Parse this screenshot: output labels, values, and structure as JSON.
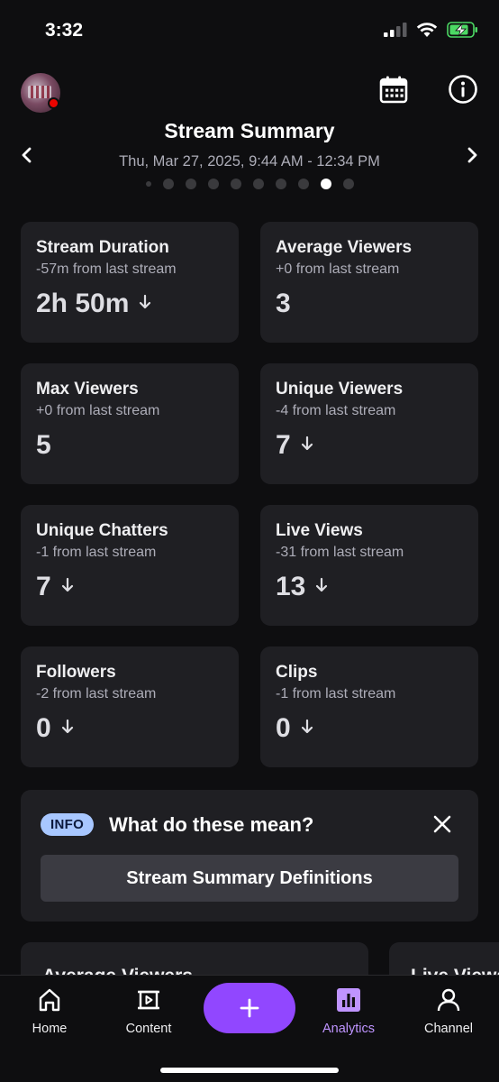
{
  "status_bar": {
    "time": "3:32"
  },
  "header": {
    "title": "Stream Summary",
    "date_range": "Thu, Mar 27, 2025, 9:44 AM - 12:34 PM",
    "pager_total": 10,
    "pager_active_index": 8
  },
  "stats": [
    {
      "title": "Stream Duration",
      "change": "-57m from last stream",
      "value": "2h 50m",
      "trend": "down"
    },
    {
      "title": "Average Viewers",
      "change": "+0 from last stream",
      "value": "3",
      "trend": "none"
    },
    {
      "title": "Max Viewers",
      "change": "+0 from last stream",
      "value": "5",
      "trend": "none"
    },
    {
      "title": "Unique Viewers",
      "change": "-4 from last stream",
      "value": "7",
      "trend": "down"
    },
    {
      "title": "Unique Chatters",
      "change": "-1 from last stream",
      "value": "7",
      "trend": "down"
    },
    {
      "title": "Live Views",
      "change": "-31 from last stream",
      "value": "13",
      "trend": "down"
    },
    {
      "title": "Followers",
      "change": "-2 from last stream",
      "value": "0",
      "trend": "down"
    },
    {
      "title": "Clips",
      "change": "-1 from last stream",
      "value": "0",
      "trend": "down"
    }
  ],
  "info_card": {
    "badge": "INFO",
    "title": "What do these mean?",
    "button_label": "Stream Summary Definitions"
  },
  "chart_cards": [
    {
      "title": "Average Viewers"
    },
    {
      "title": "Live Views"
    }
  ],
  "tabs": [
    {
      "label": "Home",
      "icon": "home-icon",
      "active": false
    },
    {
      "label": "Content",
      "icon": "content-icon",
      "active": false
    },
    {
      "label": "Analytics",
      "icon": "analytics-icon",
      "active": true
    },
    {
      "label": "Channel",
      "icon": "person-icon",
      "active": false
    }
  ],
  "colors": {
    "background": "#0e0e10",
    "card": "#1f1f23",
    "accent": "#9147ff",
    "active_tab": "#bf94ff",
    "live": "#eb0400",
    "info_badge": "#a8c7ff",
    "battery": "#4cd964"
  }
}
